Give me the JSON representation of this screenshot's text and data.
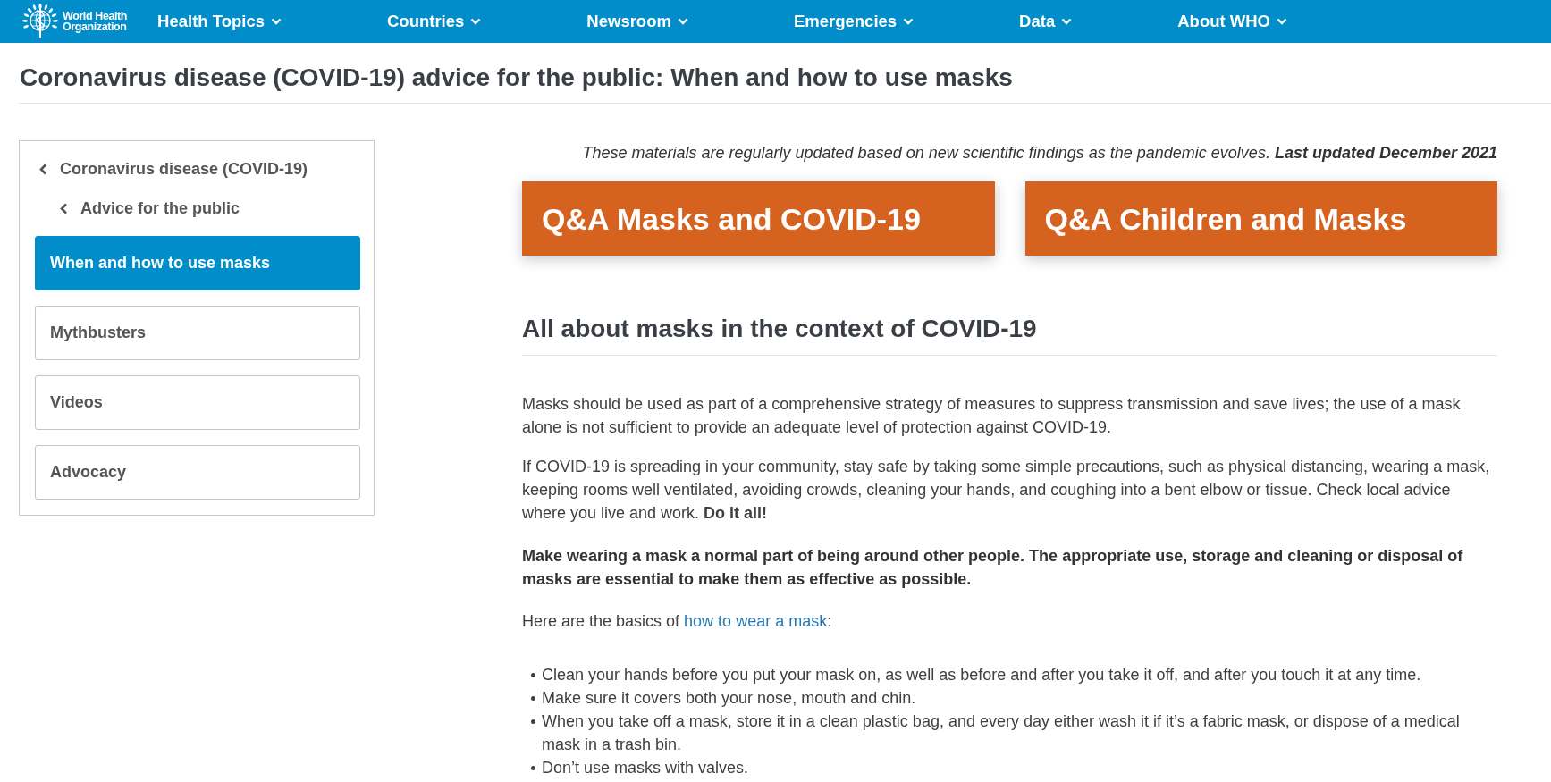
{
  "header": {
    "logo": {
      "lines": [
        "World Health",
        "Organization"
      ]
    },
    "nav": [
      {
        "label": "Health Topics"
      },
      {
        "label": "Countries"
      },
      {
        "label": "Newsroom"
      },
      {
        "label": "Emergencies"
      },
      {
        "label": "Data"
      },
      {
        "label": "About WHO"
      }
    ]
  },
  "page_title": "Coronavirus disease (COVID-19) advice for the public: When and how to use masks",
  "sidebar": {
    "back_links": [
      {
        "label": "Coronavirus disease (COVID-19)",
        "children": [
          {
            "label": "Advice for the public"
          }
        ]
      }
    ],
    "items": [
      {
        "label": "When and how to use masks",
        "selected": true
      },
      {
        "label": "Mythbusters",
        "selected": false
      },
      {
        "label": "Videos",
        "selected": false
      },
      {
        "label": "Advocacy",
        "selected": false
      }
    ]
  },
  "content": {
    "update_note": "These materials are regularly updated based on new scientific findings as the pandemic evolves. **Last updated December 2021**",
    "qa_links": [
      {
        "label": "Q&A Masks and COVID-19"
      },
      {
        "label": "Q&A Children and Masks"
      }
    ],
    "section_title": "All about masks in the context of COVID-19",
    "paragraphs": [
      "Masks should be used as part of a comprehensive strategy of measures to suppress transmission and save lives; the use of a mask alone is not sufficient to provide an adequate level of protection against COVID-19.",
      "If COVID-19 is spreading in your community, stay safe by taking some simple precautions, such as physical distancing, wearing a mask, keeping rooms well ventilated, avoiding crowds, cleaning your hands, and coughing into a bent elbow or tissue. Check local advice where you live and work. **Do it all!**"
    ],
    "emphasis": "Make wearing a mask a normal part of being around other people. The appropriate use, storage and cleaning or disposal of masks are essential to make them as effective as possible.",
    "basics": {
      "before": "Here are the basics of ",
      "link": "how to wear a mask",
      "after": ":"
    },
    "tips": [
      "Clean your hands before you put your mask on, as well as before and after you take it off, and after you touch it at any time.",
      "Make sure it covers both your nose, mouth and chin.",
      "When you take off a mask, store it in a clean plastic bag, and every day either wash it if it’s a fabric mask, or dispose of a medical mask in a trash bin.",
      "Don’t use masks with valves."
    ]
  }
}
